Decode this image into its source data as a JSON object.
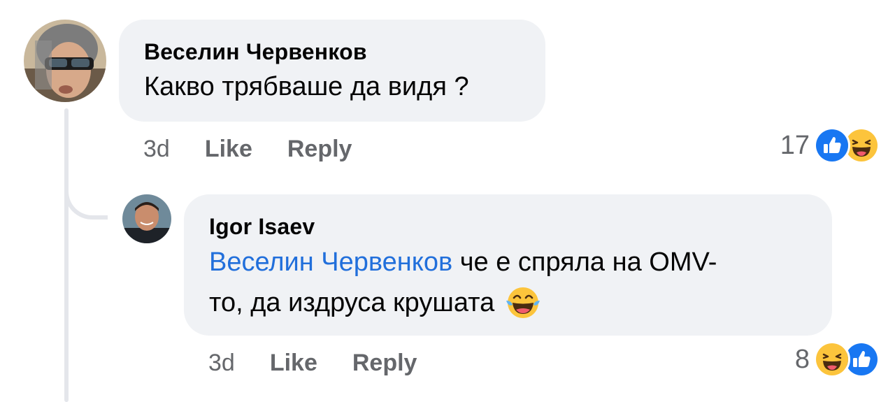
{
  "comments": [
    {
      "author": "Веселин Червенков",
      "text": "Какво трябваше да видя ?",
      "time": "3d",
      "like_label": "Like",
      "reply_label": "Reply",
      "reaction_count": "17",
      "reactions": [
        "like-icon",
        "haha-icon"
      ]
    },
    {
      "author": "Igor Isaev",
      "mention": "Веселин Червенков",
      "text_line1": " че е спряла на OMV-",
      "text_line2": "то, да издруса крушата",
      "emoji": "tears-of-joy-emoji",
      "time": "3d",
      "like_label": "Like",
      "reply_label": "Reply",
      "reaction_count": "8",
      "reactions": [
        "haha-icon",
        "like-icon"
      ]
    }
  ],
  "colors": {
    "like_blue": "#1877f2",
    "mention_blue": "#216fdb",
    "haha_yellow": "#fcc43c",
    "bubble_bg": "#f0f2f5",
    "meta_gray": "#65676b"
  }
}
